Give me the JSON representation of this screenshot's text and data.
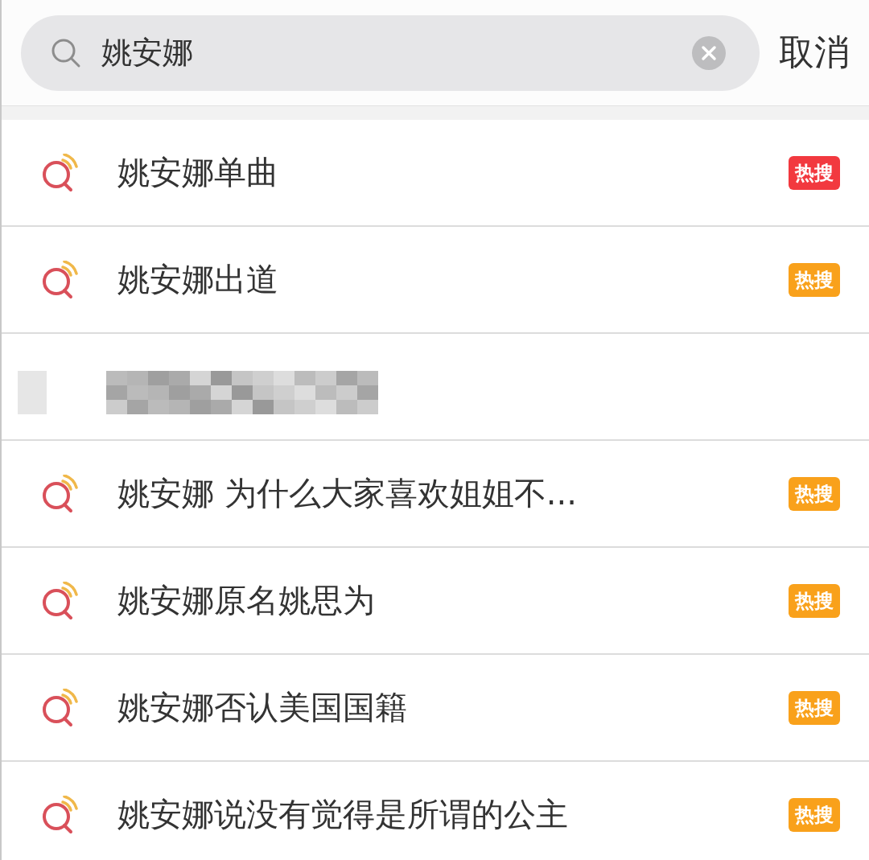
{
  "search": {
    "value": "姚安娜"
  },
  "cancel": "取消",
  "suggestions": [
    {
      "kind": "hot",
      "text": "姚安娜单曲",
      "badge": "热搜",
      "color": "#f2393f"
    },
    {
      "kind": "hot",
      "text": "姚安娜出道",
      "badge": "热搜",
      "color": "#f9a11b"
    },
    {
      "kind": "redacted"
    },
    {
      "kind": "hot",
      "text": "姚安娜 为什么大家喜欢姐姐不...",
      "badge": "热搜",
      "color": "#f9a11b"
    },
    {
      "kind": "hot",
      "text": "姚安娜原名姚思为",
      "badge": "热搜",
      "color": "#f9a11b"
    },
    {
      "kind": "hot",
      "text": "姚安娜否认美国国籍",
      "badge": "热搜",
      "color": "#f9a11b"
    },
    {
      "kind": "hot",
      "text": "姚安娜说没有觉得是所谓的公主",
      "badge": "热搜",
      "color": "#f9a11b"
    }
  ]
}
